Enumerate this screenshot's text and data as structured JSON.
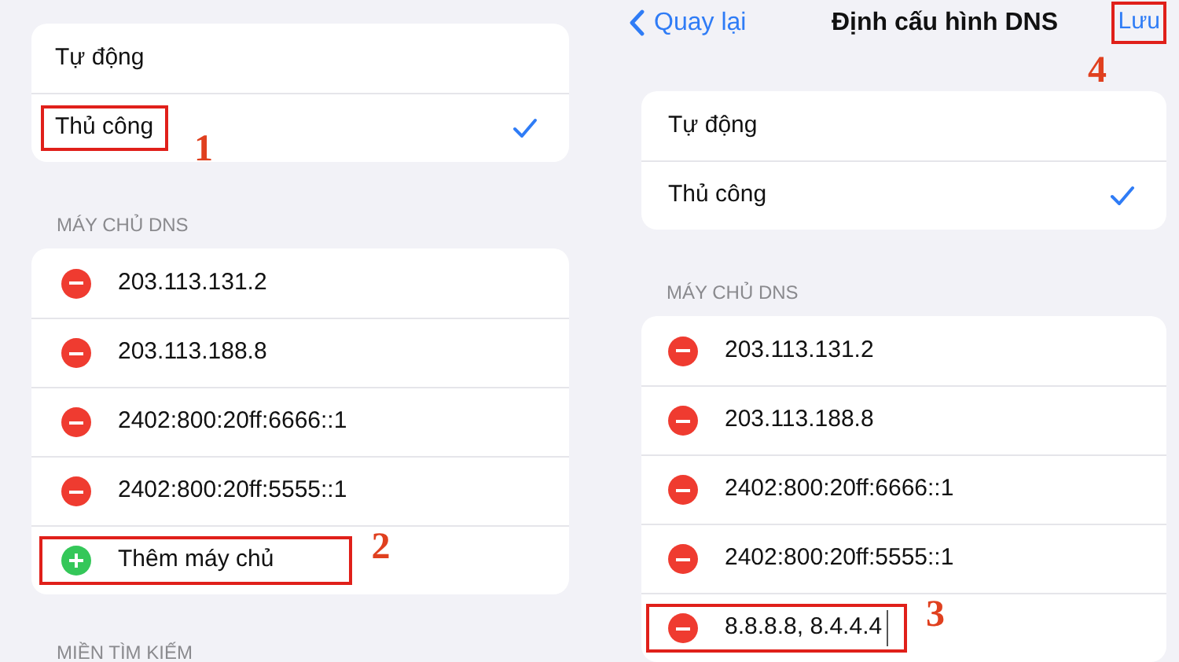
{
  "panels": [
    {
      "modes": [
        {
          "label": "Tự động",
          "selected": false
        },
        {
          "label": "Thủ công",
          "selected": true,
          "highlighted": true,
          "annotation": "1"
        }
      ],
      "dns_header": "MÁY CHỦ DNS",
      "servers": [
        {
          "kind": "entry",
          "address": "203.113.131.2"
        },
        {
          "kind": "entry",
          "address": "203.113.188.8"
        },
        {
          "kind": "entry",
          "address": "2402:800:20ff:6666::1"
        },
        {
          "kind": "entry",
          "address": "2402:800:20ff:5555::1"
        },
        {
          "kind": "add",
          "label": "Thêm máy chủ",
          "highlighted": true,
          "annotation": "2"
        }
      ],
      "next_header": "MIỀN TÌM KIẾM"
    },
    {
      "nav": {
        "back": "Quay lại",
        "title": "Định cấu hình DNS",
        "save": "Lưu",
        "save_highlighted": true,
        "save_annotation": "4"
      },
      "modes": [
        {
          "label": "Tự động",
          "selected": false
        },
        {
          "label": "Thủ công",
          "selected": true
        }
      ],
      "dns_header": "MÁY CHỦ DNS",
      "servers": [
        {
          "kind": "entry",
          "address": "203.113.131.2"
        },
        {
          "kind": "entry",
          "address": "203.113.188.8"
        },
        {
          "kind": "entry",
          "address": "2402:800:20ff:6666::1"
        },
        {
          "kind": "entry",
          "address": "2402:800:20ff:5555::1"
        },
        {
          "kind": "input",
          "value": "8.8.8.8, 8.4.4.4",
          "highlighted": true,
          "annotation": "3"
        }
      ]
    }
  ]
}
